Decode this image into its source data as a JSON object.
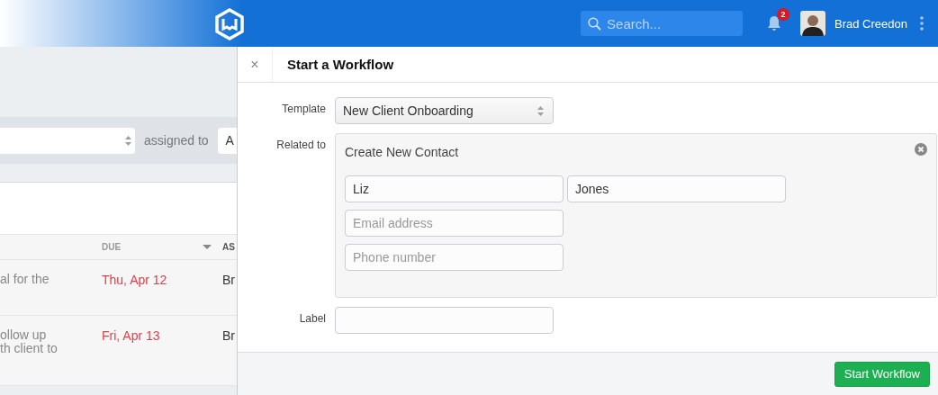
{
  "header": {
    "search_placeholder": "Search...",
    "notification_count": "2",
    "user_name": "Brad Creedon"
  },
  "background": {
    "filter_label": "assigned to",
    "assignee_value": "A",
    "columns": [
      {
        "label": "DUE",
        "sorted": true
      },
      {
        "label": "AS",
        "sorted": false
      }
    ],
    "rows": [
      {
        "title_lines": [
          "al for the"
        ],
        "due": "Thu, Apr 12",
        "assignee": "Br",
        "overdue": true
      },
      {
        "title_lines": [
          "ollow up",
          "th client to"
        ],
        "due": "Fri, Apr 13",
        "assignee": "Br",
        "overdue": true
      }
    ]
  },
  "panel": {
    "close": "×",
    "title": "Start a Workflow",
    "template": {
      "label": "Template",
      "value": "New Client Onboarding"
    },
    "related": {
      "label": "Related to",
      "heading": "Create New Contact",
      "first_name": "Liz",
      "last_name": "Jones",
      "email_placeholder": "Email address",
      "phone_placeholder": "Phone number"
    },
    "label_field": {
      "label": "Label"
    },
    "submit": "Start Workflow"
  }
}
